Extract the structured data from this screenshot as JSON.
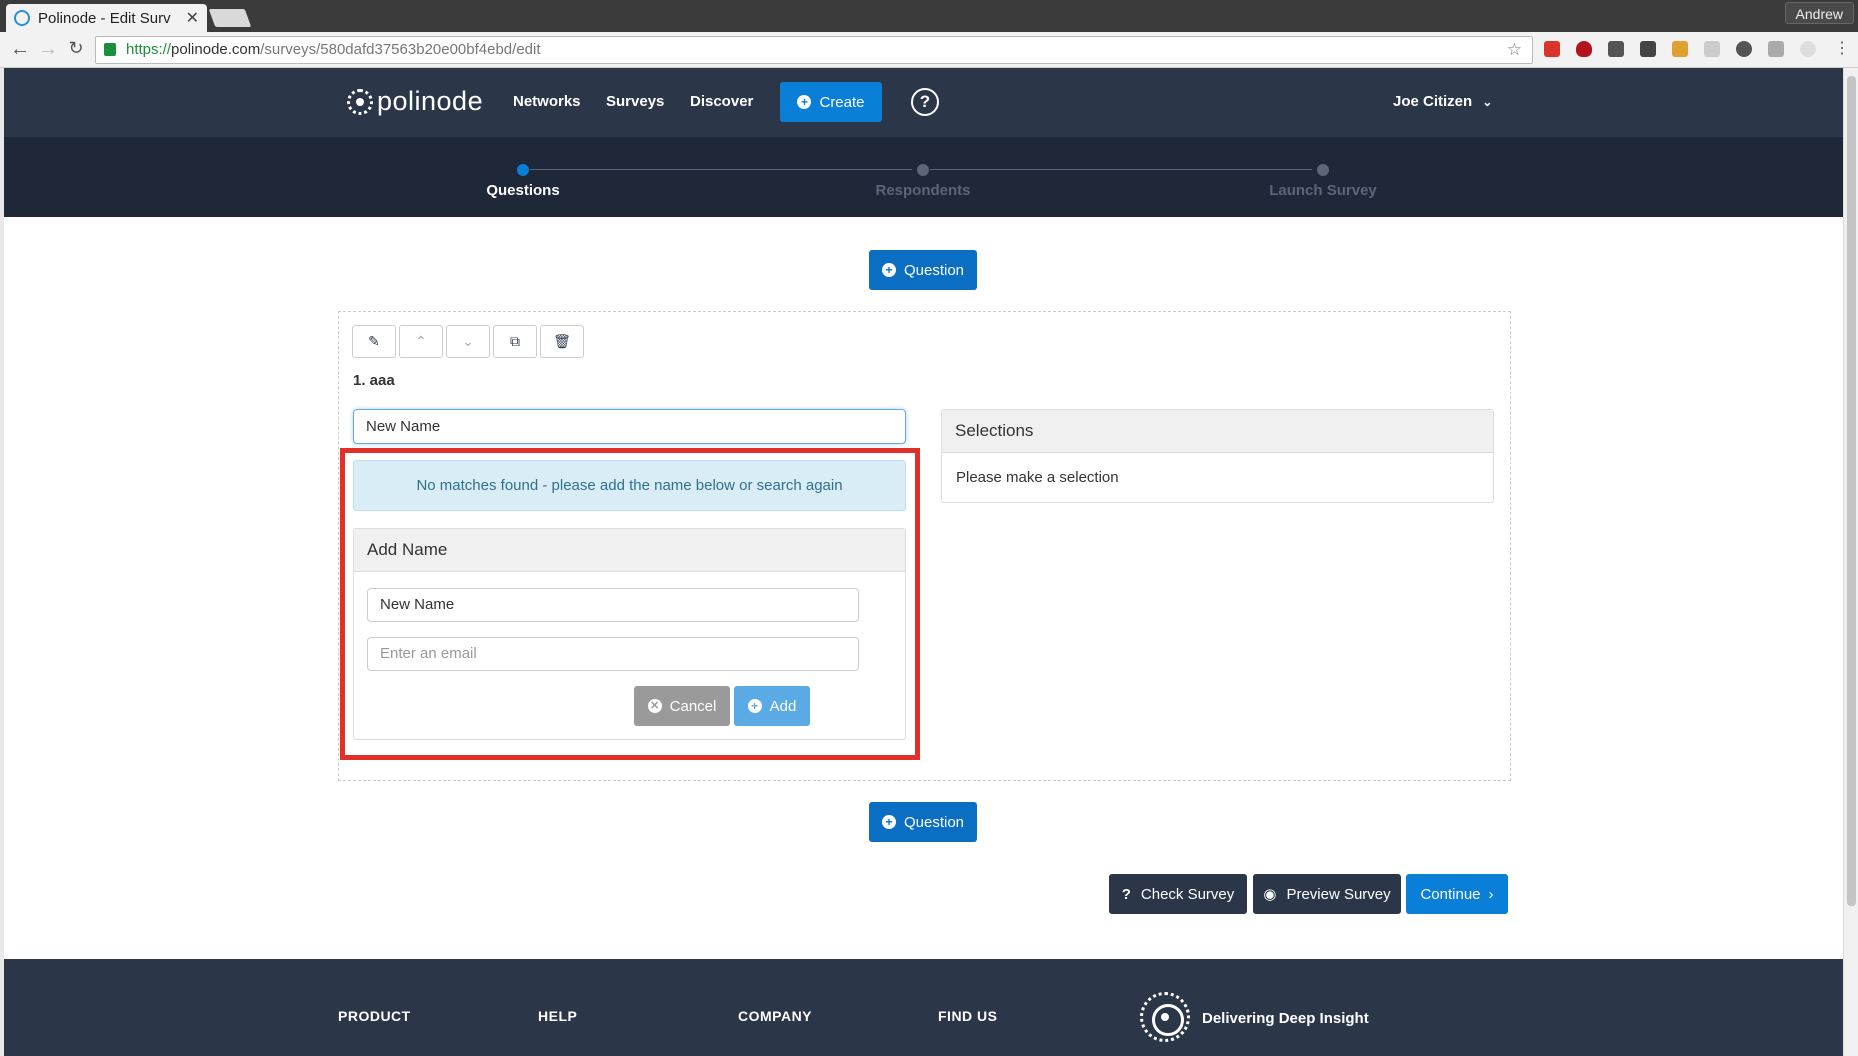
{
  "browser": {
    "tab_title": "Polinode - Edit Surv",
    "profile_name": "Andrew",
    "url_scheme": "https://",
    "url_host": "polinode.com",
    "url_path": "/surveys/580dafd37563b20e00bf4ebd/edit"
  },
  "header": {
    "logo_text": "polinode",
    "nav": [
      "Networks",
      "Surveys",
      "Discover"
    ],
    "create_label": "Create",
    "help_symbol": "?",
    "user_name": "Joe Citizen"
  },
  "steps": [
    {
      "label": "Questions",
      "active": true
    },
    {
      "label": "Respondents",
      "active": false
    },
    {
      "label": "Launch Survey",
      "active": false
    }
  ],
  "main": {
    "add_question_label": "Question",
    "question_title": "1. aaa",
    "search_value": "New Name",
    "no_match_message": "No matches found - please add the name below or search again",
    "add_name_panel": {
      "title": "Add Name",
      "name_value": "New Name",
      "email_placeholder": "Enter an email",
      "cancel_label": "Cancel",
      "add_label": "Add"
    },
    "selections_panel": {
      "title": "Selections",
      "empty_text": "Please make a selection"
    },
    "actions": {
      "check_label": "Check Survey",
      "preview_label": "Preview Survey",
      "continue_label": "Continue"
    }
  },
  "footer": {
    "columns": [
      "PRODUCT",
      "HELP",
      "COMPANY",
      "FIND US"
    ],
    "tagline": "Delivering Deep Insight"
  },
  "colors": {
    "brand_dark": "#2b3649",
    "primary": "#0a7fd8",
    "highlight": "#e03027",
    "info_bg": "#d9edf7"
  }
}
